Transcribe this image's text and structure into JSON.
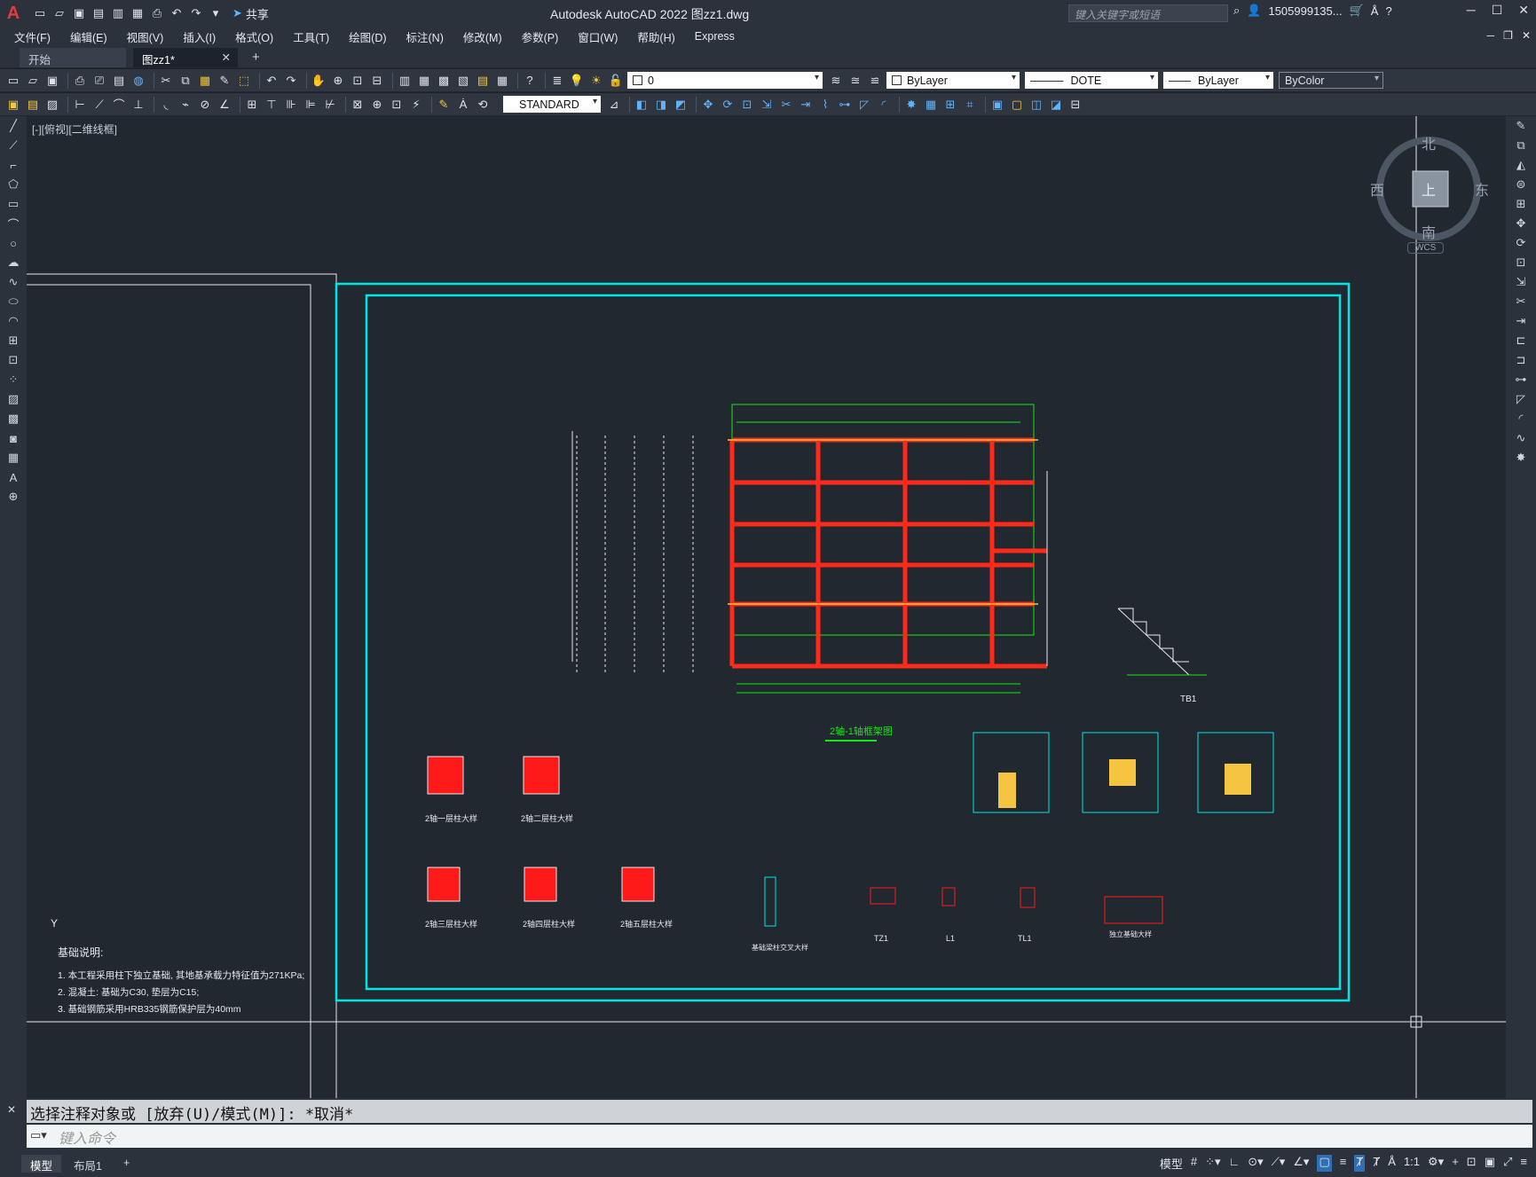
{
  "titlebar": {
    "app_title": "Autodesk AutoCAD 2022    图zz1.dwg",
    "share_label": "共享",
    "search_placeholder": "键入关键字或短语",
    "user_label": "1505999135...",
    "logo_letter": "A"
  },
  "menu": [
    "文件(F)",
    "编辑(E)",
    "视图(V)",
    "插入(I)",
    "格式(O)",
    "工具(T)",
    "绘图(D)",
    "标注(N)",
    "修改(M)",
    "参数(P)",
    "窗口(W)",
    "帮助(H)",
    "Express"
  ],
  "tabs": {
    "start": "开始",
    "doc": "图zz1*",
    "add": "+"
  },
  "toolbar": {
    "layer_value": "0",
    "color_value": "ByLayer",
    "linetype_value": "DOTE",
    "lineweight_value": "ByLayer",
    "plotstyle_value": "ByColor",
    "textstyle_value": "STANDARD"
  },
  "viewport": {
    "label": "[-][俯视][二维线框]",
    "compass": {
      "north": "北",
      "south": "南",
      "east": "东",
      "west": "西",
      "top": "上",
      "wcs": "WCS"
    }
  },
  "drawing": {
    "notes_title": "基础说明:",
    "notes": [
      "1. 本工程采用柱下独立基础, 其地基承载力特征值为271KPa;",
      "2. 混凝土: 基础为C30, 垫层为C15;",
      "3. 基础钢筋采用HRB335钢筋保护层为40mm"
    ],
    "plan_title": "2轴-1轴框架图",
    "stair_title": "TB1",
    "detail_labels": [
      "2轴一层柱大样",
      "2轴二层柱大样",
      "2轴三层柱大样",
      "2轴四层柱大样",
      "2轴五层柱大样",
      "基础梁柱交叉大样",
      "TZ1",
      "L1",
      "TL1",
      "独立基础大样"
    ]
  },
  "command": {
    "history": "选择注释对象或 [放弃(U)/模式(M)]: *取消*",
    "placeholder": "键入命令"
  },
  "status": {
    "model_tab": "模型",
    "layout_tab": "布局1",
    "add": "+",
    "scale": "1:1"
  },
  "colors": {
    "frame": "#00e5e5",
    "beam": "#ff1a1a",
    "dim": "#19e619",
    "cad_bg": "#212830"
  }
}
